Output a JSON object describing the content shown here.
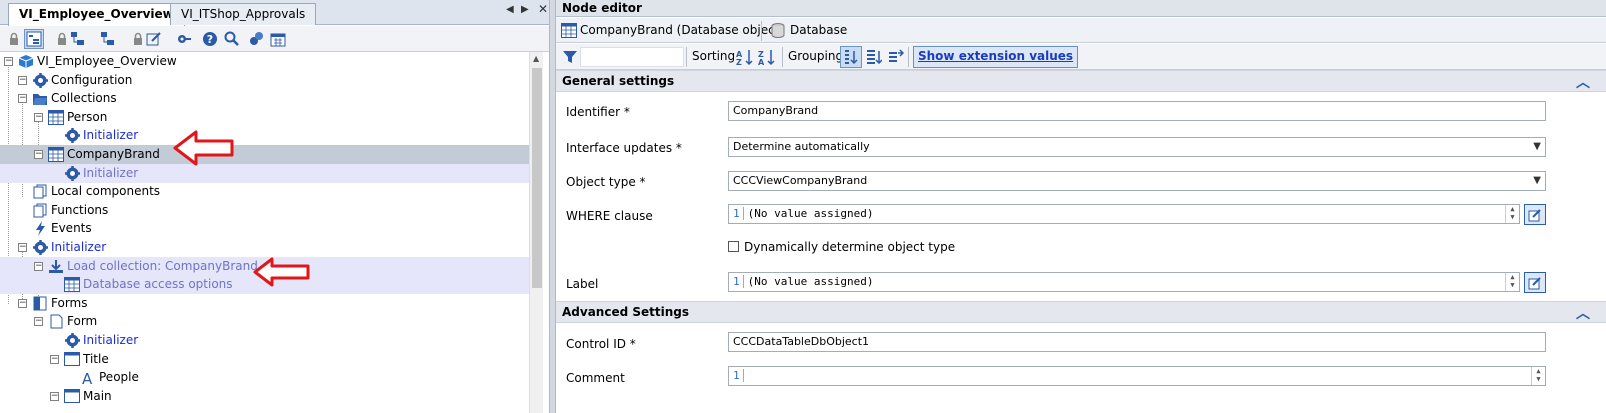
{
  "left_tabs": [
    "VI_Employee_Overview",
    "VI_ITShop_Approvals"
  ],
  "tree": [
    {
      "label": "VI_Employee_Overview",
      "icon": "cube-icon",
      "style": "normal",
      "row": "normal"
    },
    {
      "label": "Configuration",
      "icon": "gear-icon",
      "style": "normal",
      "row": "normal"
    },
    {
      "label": "Collections",
      "icon": "folder-icon",
      "style": "normal",
      "row": "normal"
    },
    {
      "label": "Person",
      "icon": "table-icon",
      "style": "normal",
      "row": "normal"
    },
    {
      "label": "Initializer",
      "icon": "gear-icon",
      "style": "blue",
      "row": "normal"
    },
    {
      "label": "CompanyBrand",
      "icon": "table-icon",
      "style": "normal",
      "row": "selected"
    },
    {
      "label": "Initializer",
      "icon": "gear-icon",
      "style": "purple",
      "row": "alt"
    },
    {
      "label": "Local components",
      "icon": "pages-icon",
      "style": "normal",
      "row": "normal"
    },
    {
      "label": "Functions",
      "icon": "pages-icon",
      "style": "normal",
      "row": "normal"
    },
    {
      "label": "Events",
      "icon": "lightning-icon",
      "style": "normal",
      "row": "normal"
    },
    {
      "label": "Initializer",
      "icon": "gear-icon",
      "style": "blue",
      "row": "normal"
    },
    {
      "label": "Load collection: CompanyBrand",
      "icon": "download-icon",
      "style": "purple",
      "row": "alt"
    },
    {
      "label": "Database access options",
      "icon": "table-icon",
      "style": "purple",
      "row": "alt"
    },
    {
      "label": "Forms",
      "icon": "forms-icon",
      "style": "normal",
      "row": "normal"
    },
    {
      "label": "Form",
      "icon": "page-icon",
      "style": "normal",
      "row": "normal"
    },
    {
      "label": "Initializer",
      "icon": "gear-icon",
      "style": "blue",
      "row": "normal"
    },
    {
      "label": "Title",
      "icon": "window-icon",
      "style": "normal",
      "row": "normal"
    },
    {
      "label": "People",
      "icon": "letter-a-icon",
      "style": "normal",
      "row": "normal"
    },
    {
      "label": "Main",
      "icon": "window-icon",
      "style": "normal",
      "row": "normal"
    }
  ],
  "node_editor": {
    "title": "Node editor",
    "crumbs": [
      "CompanyBrand (Database object)",
      "Database"
    ],
    "toolbar": {
      "sorting": "Sorting",
      "grouping": "Grouping",
      "show_ext": "Show extension values"
    },
    "general_title": "General settings",
    "advanced_title": "Advanced Settings",
    "fields": {
      "identifier_label": "Identifier *",
      "identifier_value": "CompanyBrand",
      "interface_label": "Interface updates *",
      "interface_value": "Determine automatically",
      "objtype_label": "Object type *",
      "objtype_value": "CCCViewCompanyBrand",
      "where_label": "WHERE clause",
      "where_value": "(No value assigned)",
      "dyn_label": "Dynamically determine object type",
      "label_label": "Label",
      "label_value": "(No value assigned)",
      "control_label": "Control ID *",
      "control_value": "CCCDataTableDbObject1",
      "comment_label": "Comment",
      "line_no": "1"
    }
  },
  "colors": {
    "arrow": "#e0161b",
    "accent": "#2f5faa",
    "selected_row": "#c3cbd6",
    "alt_row": "#e6e6fa"
  }
}
